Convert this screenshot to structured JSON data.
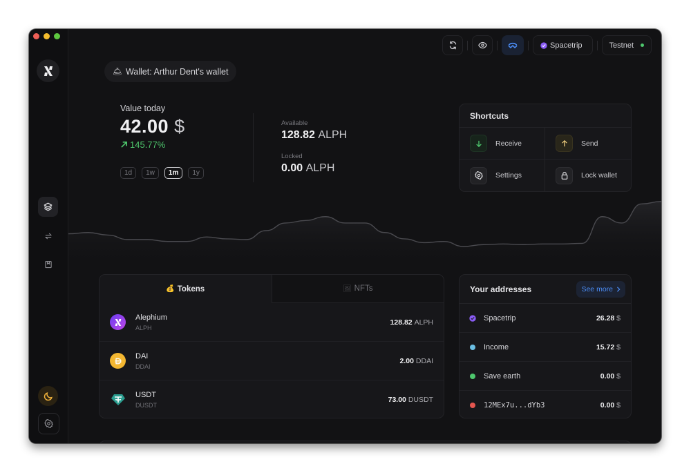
{
  "window": {
    "traffic_lights": {
      "close": "#ee5f57",
      "minimize": "#f5bd2e",
      "maximize": "#5ec840"
    }
  },
  "sidebar": {
    "logo_icon": "alephium-logo-icon",
    "nav_items": [
      {
        "name": "overview",
        "icon": "layers-icon",
        "active": true
      },
      {
        "name": "transfers",
        "icon": "arrows-transfer-icon",
        "active": false
      },
      {
        "name": "address-book",
        "icon": "bookmark-book-icon",
        "active": false
      }
    ],
    "bottom_items": [
      {
        "name": "theme-toggle",
        "icon": "moon-icon",
        "color": "#f2b33b"
      },
      {
        "name": "settings",
        "icon": "gear-icon"
      }
    ]
  },
  "topbar": {
    "refresh_icon": "refresh-icon",
    "privacy_icon": "eye-icon",
    "walletconnect_icon": "walletconnect-icon",
    "default_address": "Spacetrip",
    "network": "Testnet",
    "network_status_color": "#4ec76d"
  },
  "wallet": {
    "label": "Wallet: Arthur Dent's wallet",
    "emoji": "🛎"
  },
  "value": {
    "label": "Value today",
    "amount": "42.00",
    "currency": "$",
    "change": "145.77%",
    "change_direction": "up",
    "periods": [
      "1d",
      "1w",
      "1m",
      "1y"
    ],
    "active_period": "1m"
  },
  "balances": {
    "available_label": "Available",
    "available_amount": "128.82",
    "available_unit": "ALPH",
    "locked_label": "Locked",
    "locked_amount": "0.00",
    "locked_unit": "ALPH"
  },
  "shortcuts": {
    "title": "Shortcuts",
    "items": [
      {
        "label": "Receive",
        "icon": "arrow-down-icon"
      },
      {
        "label": "Send",
        "icon": "arrow-up-icon"
      },
      {
        "label": "Settings",
        "icon": "gear-icon"
      },
      {
        "label": "Lock wallet",
        "icon": "lock-icon"
      }
    ]
  },
  "history_chart": {
    "type": "area",
    "values": [
      45,
      47,
      43,
      36,
      36,
      33,
      33,
      40,
      37,
      36,
      50,
      62,
      66,
      72,
      62,
      62,
      47,
      37,
      31,
      33,
      25,
      28,
      29,
      28,
      29,
      29,
      30,
      72,
      62,
      92,
      96
    ]
  },
  "tokens_card": {
    "tabs": [
      {
        "label": "Tokens",
        "emoji": "💰",
        "active": true
      },
      {
        "label": "NFTs",
        "emoji": "🖼",
        "active": false
      }
    ],
    "tokens": [
      {
        "name": "Alephium",
        "symbol": "ALPH",
        "amount": "128.82",
        "unit": "ALPH",
        "icon": "alephium-token-icon"
      },
      {
        "name": "DAI",
        "symbol": "DDAI",
        "amount": "2.00",
        "unit": "DDAI",
        "icon": "dai-token-icon"
      },
      {
        "name": "USDT",
        "symbol": "DUSDT",
        "amount": "73.00",
        "unit": "DUSDT",
        "icon": "tether-token-icon"
      }
    ]
  },
  "addresses_card": {
    "title": "Your addresses",
    "see_more": "See more",
    "addresses": [
      {
        "label": "Spacetrip",
        "value": "26.28",
        "currency": "$",
        "color": "#8a5cf5",
        "default": true
      },
      {
        "label": "Income",
        "value": "15.72",
        "currency": "$",
        "color": "#6bbfe3",
        "default": false
      },
      {
        "label": "Save earth",
        "value": "0.00",
        "currency": "$",
        "color": "#4ec76d",
        "default": false
      },
      {
        "label": "12MEx7u...dYb3",
        "value": "0.00",
        "currency": "$",
        "color": "#e5564f",
        "default": false,
        "mono": true
      }
    ]
  }
}
